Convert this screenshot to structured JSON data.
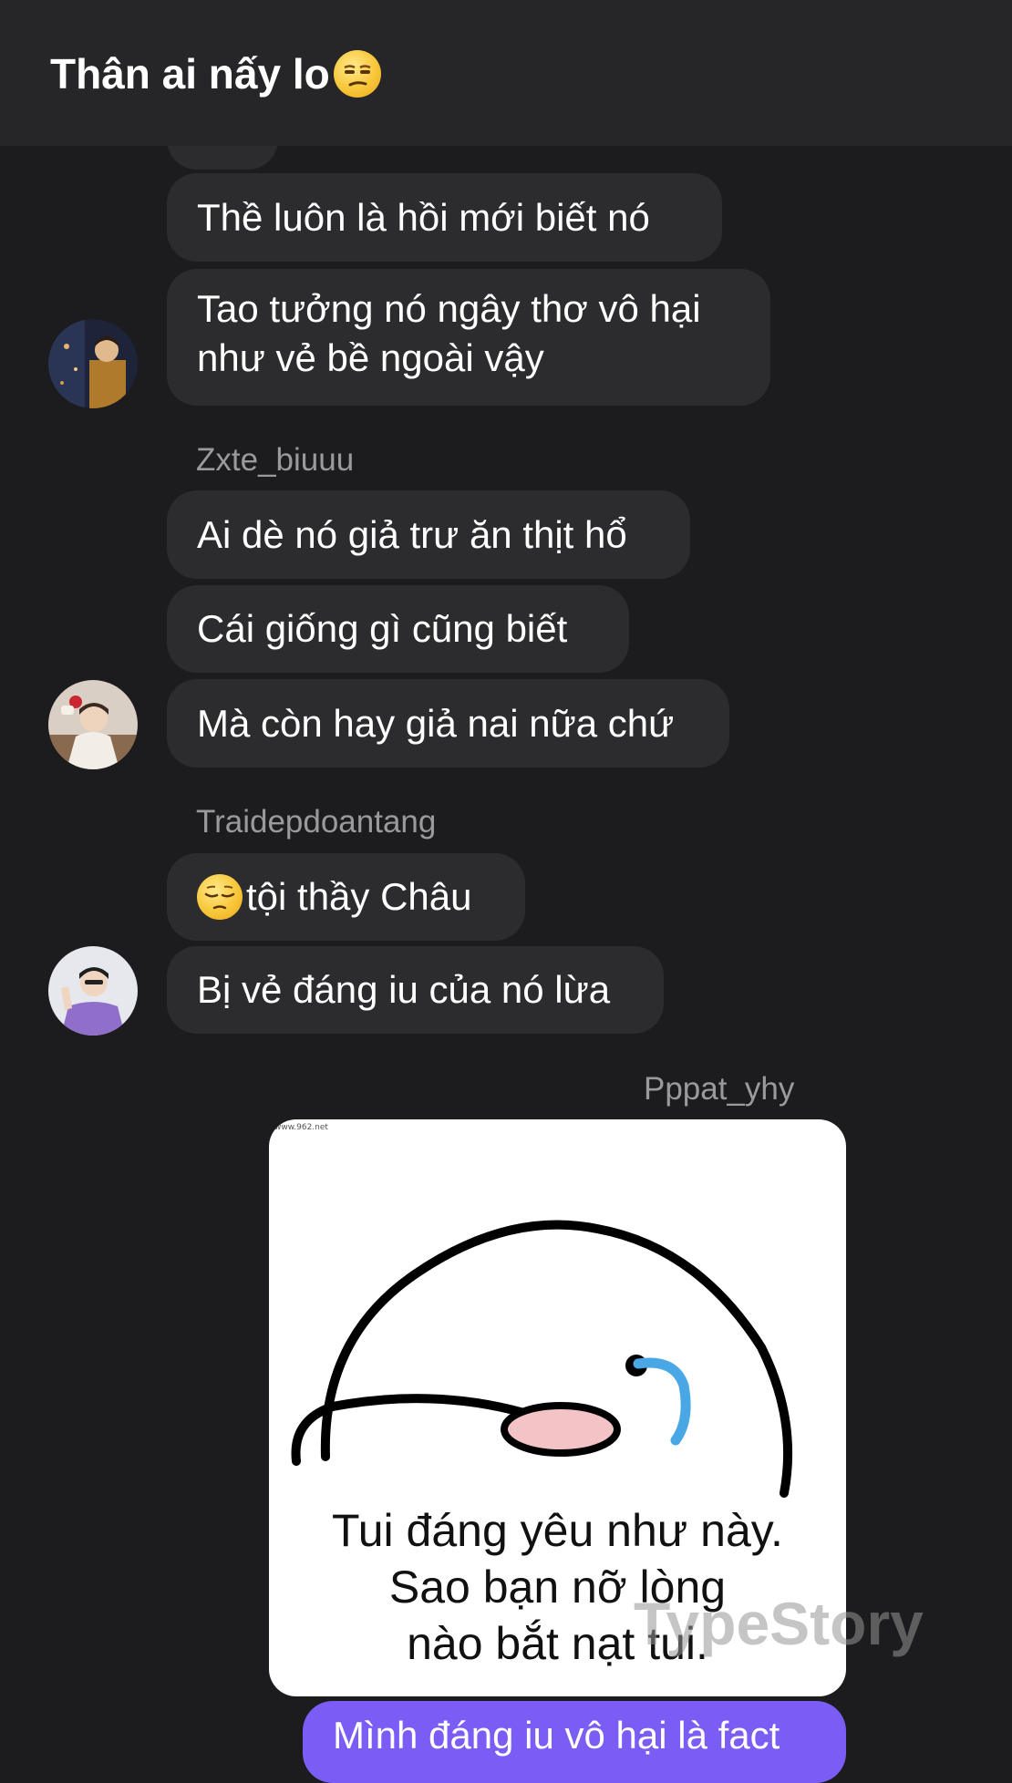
{
  "header": {
    "title": "Thân ai nấy lo",
    "title_emoji": "unamused-face"
  },
  "messages": {
    "m1": "Thề luôn là hồi mới biết nó",
    "m2_line1": "Tao tưởng nó ngây thơ vô hại",
    "m2_line2": "như vẻ bề ngoài vậy",
    "sender2": "Zxte_biuuu",
    "m3": "Ai dè nó giả trư ăn thịt hổ",
    "m4": "Cái giống gì cũng biết",
    "m5": "Mà còn hay giả nai nữa chứ",
    "sender3": "Traidepdoantang",
    "m6": "tội thầy Châu",
    "m6_emoji": "pensive-face",
    "m7": "Bị vẻ đáng iu của nó lừa",
    "sender4": "Pppat_yhy",
    "m8_partial": "Mình đáng iu vô hại là fact"
  },
  "sticker": {
    "url_text": "www.962.net",
    "line1": "Tui đáng yêu như này.",
    "line2": "Sao bạn nỡ lòng",
    "line3": "nào bắt nạt tui."
  },
  "watermark": "TypeStory",
  "colors": {
    "background": "#1c1c1e",
    "header": "#262628",
    "incoming_bubble": "#2c2c2e",
    "outgoing_bubble": "#7b5cf5",
    "sender_name": "#9a9a9e"
  }
}
